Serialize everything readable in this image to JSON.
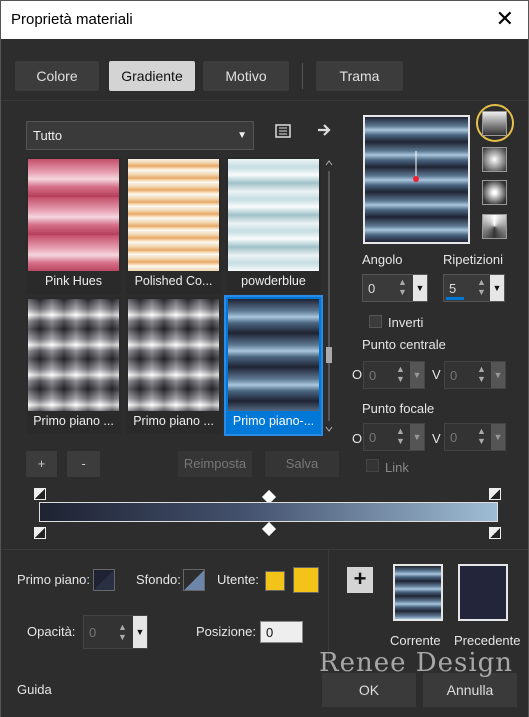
{
  "window": {
    "title": "Proprietà materiali",
    "close_glyph": "✕"
  },
  "tabs": [
    {
      "label": "Colore"
    },
    {
      "label": "Gradiente",
      "active": true
    },
    {
      "label": "Motivo"
    },
    {
      "label": "Trama"
    }
  ],
  "category": {
    "selected": "Tutto"
  },
  "gradients": [
    {
      "label": "Pink Hues"
    },
    {
      "label": "Polished Co..."
    },
    {
      "label": "powderblue"
    },
    {
      "label": "Primo piano ..."
    },
    {
      "label": "Primo piano ..."
    },
    {
      "label": "Primo piano-...",
      "selected": true
    }
  ],
  "list_buttons": {
    "add": "+",
    "remove": "-",
    "reset": "Reimposta",
    "save": "Salva"
  },
  "settings": {
    "angle_label": "Angolo",
    "angle_value": "0",
    "repeats_label": "Ripetizioni",
    "repeats_value": "5",
    "invert_label": "Inverti",
    "center_label": "Punto centrale",
    "center_h_label": "O",
    "center_h_value": "0",
    "center_v_label": "V",
    "center_v_value": "0",
    "focal_label": "Punto focale",
    "focal_h_label": "O",
    "focal_h_value": "0",
    "focal_v_label": "V",
    "focal_v_value": "0",
    "link_label": "Link"
  },
  "bottom": {
    "foreground_label": "Primo piano:",
    "background_label": "Sfondo:",
    "user_label": "Utente:",
    "opacity_label": "Opacità:",
    "opacity_value": "0",
    "position_label": "Posizione:",
    "position_value": "0",
    "current_label": "Corrente",
    "previous_label": "Precedente",
    "add_glyph": "+"
  },
  "footer": {
    "help": "Guida",
    "ok": "OK",
    "cancel": "Annulla",
    "watermark": "Renee Design"
  },
  "colors": {
    "accent": "#0078d7",
    "highlight_ring": "#e5c14a",
    "user_color": "#f2c318",
    "previous_color": "#23253a",
    "gradient_dark": "#1e2232",
    "gradient_light": "#9fbdd6"
  }
}
